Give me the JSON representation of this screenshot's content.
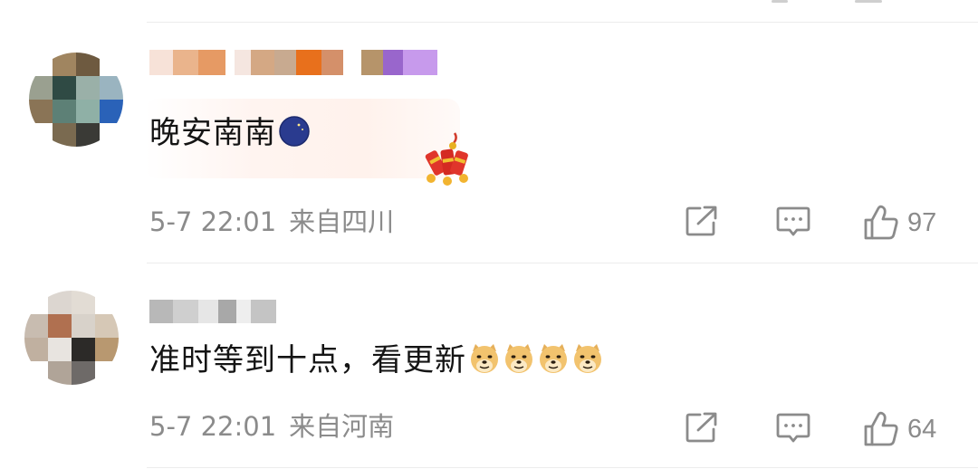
{
  "comments": [
    {
      "text": "晚安南南",
      "emoji": "crescent-moon-emoji",
      "decoration": "firecracker-decoration",
      "time": "5-7 22:01",
      "location": "来自四川",
      "likes": "97"
    },
    {
      "text": "准时等到十点，看更新",
      "emoji": "doge-emoji",
      "emoji_count": 4,
      "time": "5-7 22:01",
      "location": "来自河南",
      "likes": "64"
    }
  ],
  "icons": {
    "share": "share-icon",
    "reply": "comment-icon",
    "like": "thumbs-up-icon"
  },
  "colors": {
    "meta_text": "#8b8b8b",
    "comment_text": "#141414",
    "divider": "#ececec",
    "card_tint": "#fff2ec"
  }
}
